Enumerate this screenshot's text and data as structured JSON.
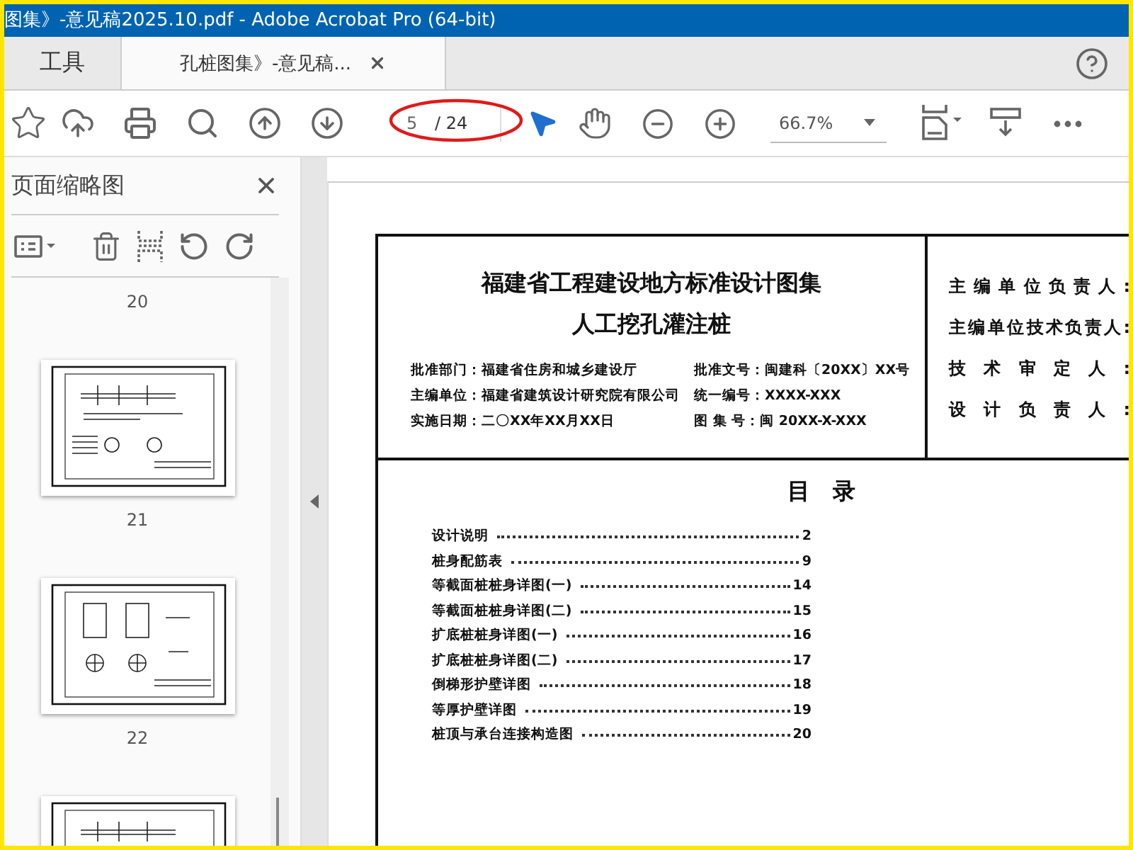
{
  "window": {
    "title": "图集》-意见稿2025.10.pdf - Adobe Acrobat Pro (64-bit)"
  },
  "tabs": [
    {
      "kind": "home",
      "label": "工具",
      "selected": false
    },
    {
      "kind": "document",
      "label": "孔桩图集》-意见稿...",
      "selected": true
    }
  ],
  "toolbar": {
    "page": {
      "value": "5",
      "total": "/ 24"
    },
    "zoom": "66.7%",
    "annotation": {
      "kind": "ellipse"
    }
  },
  "sidebar": {
    "title": "页面缩略图",
    "items": [
      {
        "kind": "label",
        "text": "20"
      },
      {
        "kind": "thumbnail"
      },
      {
        "kind": "label",
        "text": "21"
      },
      {
        "kind": "thumbnail"
      },
      {
        "kind": "label",
        "text": "22"
      },
      {
        "kind": "thumbnail"
      }
    ]
  },
  "document": {
    "title": "福建省工程建设地方标准设计图集",
    "subtitle": "人工挖孔灌注桩",
    "fields": [
      "批准部门：福建省住房和城乡建设厅",
      "批准文号：闽建科〔20XX〕XX号",
      "主编单位：福建省建筑设计研究院有限公司",
      "统一编号：XXXX-XXX",
      "实施日期：二〇XX年XX月XX日",
      "图 集 号：闽 20XX-X-XXX"
    ],
    "roles": [
      "主编单位负责人:",
      "主编单位技术负责人:",
      "技术审定人:",
      "设计负责人:"
    ],
    "toc_title": "目　录",
    "toc": [
      {
        "title": "设计说明",
        "page": "2"
      },
      {
        "title": "桩身配筋表",
        "page": "9"
      },
      {
        "title": "等截面桩桩身详图(一)",
        "page": "14"
      },
      {
        "title": "等截面桩桩身详图(二)",
        "page": "15"
      },
      {
        "title": "扩底桩桩身详图(一)",
        "page": "16"
      },
      {
        "title": "扩底桩桩身详图(二)",
        "page": "17"
      },
      {
        "title": "倒梯形护壁详图",
        "page": "18"
      },
      {
        "title": "等厚护壁详图",
        "page": "19"
      },
      {
        "title": "桩顶与承台连接构造图",
        "page": "20"
      }
    ]
  }
}
